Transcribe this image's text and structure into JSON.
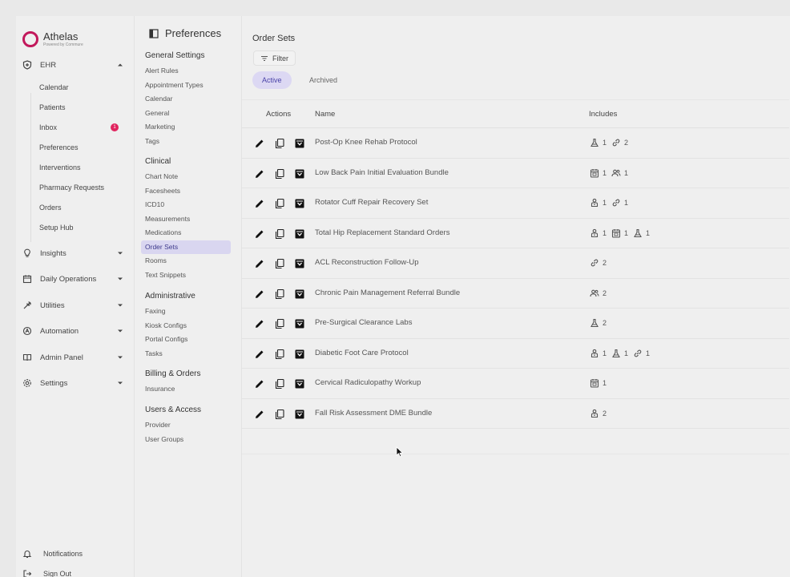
{
  "app": {
    "brand_name": "Athelas",
    "brand_sub": "Powered by Commure",
    "brand_color": "#c2185b"
  },
  "sidebar": {
    "ehr_label": "EHR",
    "ehr_items": [
      {
        "label": "Calendar"
      },
      {
        "label": "Patients"
      },
      {
        "label": "Inbox",
        "badge": "1"
      },
      {
        "label": "Preferences"
      },
      {
        "label": "Interventions"
      },
      {
        "label": "Pharmacy Requests"
      },
      {
        "label": "Orders"
      },
      {
        "label": "Setup Hub"
      }
    ],
    "sections": [
      {
        "label": "Insights",
        "icon": "lightbulb-icon"
      },
      {
        "label": "Daily Operations",
        "icon": "calendar-icon"
      },
      {
        "label": "Utilities",
        "icon": "wrench-icon"
      },
      {
        "label": "Automation",
        "icon": "automation-icon"
      },
      {
        "label": "Admin Panel",
        "icon": "book-icon"
      },
      {
        "label": "Settings",
        "icon": "gear-icon"
      }
    ],
    "notifications_label": "Notifications",
    "signout_label": "Sign Out"
  },
  "preferences": {
    "title": "Preferences",
    "groups": [
      {
        "title": "General Settings",
        "items": [
          "Alert Rules",
          "Appointment Types",
          "Calendar",
          "General",
          "Marketing",
          "Tags"
        ]
      },
      {
        "title": "Clinical",
        "items": [
          "Chart Note",
          "Facesheets",
          "ICD10",
          "Measurements",
          "Medications",
          "Order Sets",
          "Rooms",
          "Text Snippets"
        ]
      },
      {
        "title": "Administrative",
        "items": [
          "Faxing",
          "Kiosk Configs",
          "Portal Configs",
          "Tasks"
        ]
      },
      {
        "title": "Billing & Orders",
        "items": [
          "Insurance"
        ]
      },
      {
        "title": "Users & Access",
        "items": [
          "Provider",
          "User Groups"
        ]
      }
    ],
    "active_item": "Order Sets"
  },
  "main": {
    "title": "Order Sets",
    "filter_label": "Filter",
    "tabs": [
      {
        "label": "Active",
        "active": true
      },
      {
        "label": "Archived",
        "active": false
      }
    ],
    "columns": {
      "actions": "Actions",
      "name": "Name",
      "includes": "Includes"
    },
    "rows": [
      {
        "name": "Post-Op Knee Rehab Protocol",
        "includes": [
          {
            "icon": "flask-icon",
            "count": "1"
          },
          {
            "icon": "link-icon",
            "count": "2"
          }
        ]
      },
      {
        "name": "Low Back Pain Initial Evaluation Bundle",
        "includes": [
          {
            "icon": "calendar-grid-icon",
            "count": "1"
          },
          {
            "icon": "people-icon",
            "count": "1"
          }
        ]
      },
      {
        "name": "Rotator Cuff Repair Recovery Set",
        "includes": [
          {
            "icon": "person-badge-icon",
            "count": "1"
          },
          {
            "icon": "link-icon",
            "count": "1"
          }
        ]
      },
      {
        "name": "Total Hip Replacement Standard Orders",
        "includes": [
          {
            "icon": "person-badge-icon",
            "count": "1"
          },
          {
            "icon": "calendar-grid-icon",
            "count": "1"
          },
          {
            "icon": "flask-icon",
            "count": "1"
          }
        ]
      },
      {
        "name": "ACL Reconstruction Follow-Up",
        "includes": [
          {
            "icon": "link-icon",
            "count": "2"
          }
        ]
      },
      {
        "name": "Chronic Pain Management Referral Bundle",
        "includes": [
          {
            "icon": "people-icon",
            "count": "2"
          }
        ]
      },
      {
        "name": "Pre-Surgical Clearance Labs",
        "includes": [
          {
            "icon": "flask-icon",
            "count": "2"
          }
        ]
      },
      {
        "name": "Diabetic Foot Care Protocol",
        "includes": [
          {
            "icon": "person-badge-icon",
            "count": "1"
          },
          {
            "icon": "flask-icon",
            "count": "1"
          },
          {
            "icon": "link-icon",
            "count": "1"
          }
        ]
      },
      {
        "name": "Cervical Radiculopathy Workup",
        "includes": [
          {
            "icon": "calendar-grid-icon",
            "count": "1"
          }
        ]
      },
      {
        "name": "Fall Risk Assessment DME Bundle",
        "includes": [
          {
            "icon": "person-badge-icon",
            "count": "2"
          }
        ]
      }
    ]
  }
}
